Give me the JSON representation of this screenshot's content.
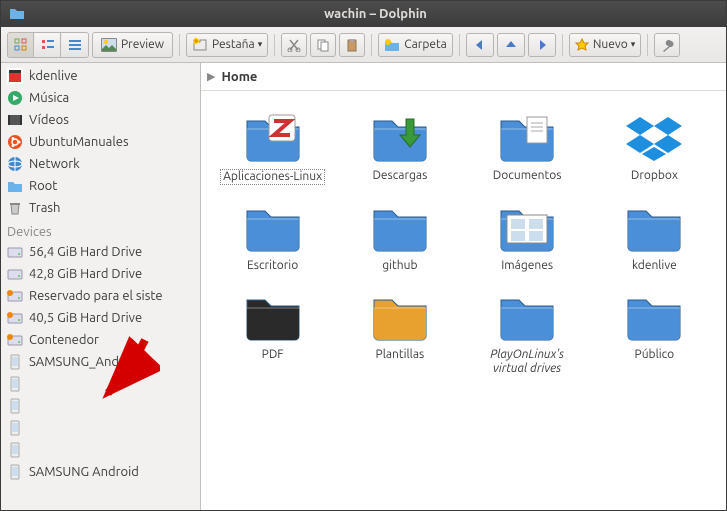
{
  "window": {
    "title": "wachin – Dolphin"
  },
  "toolbar": {
    "preview_label": "Preview",
    "tab_label": "Pestaña",
    "folder_label": "Carpeta",
    "new_label": "Nuevo"
  },
  "breadcrumb": {
    "home": "Home"
  },
  "sidebar": {
    "places": [
      {
        "label": "kdenlive",
        "icon": "app-red"
      },
      {
        "label": "Música",
        "icon": "media-play"
      },
      {
        "label": "Vídeos",
        "icon": "video"
      },
      {
        "label": "UbuntuManuales",
        "icon": "ubuntu"
      },
      {
        "label": "Network",
        "icon": "network"
      },
      {
        "label": "Root",
        "icon": "folder-small"
      },
      {
        "label": "Trash",
        "icon": "trash"
      }
    ],
    "devices_header": "Devices",
    "devices": [
      {
        "label": "56,4 GiB Hard Drive",
        "icon": "drive"
      },
      {
        "label": "42,8 GiB Hard Drive",
        "icon": "drive"
      },
      {
        "label": "Reservado para el siste",
        "icon": "drive-orange"
      },
      {
        "label": "40,5 GiB Hard Drive",
        "icon": "drive-orange"
      },
      {
        "label": "Contenedor",
        "icon": "drive-orange"
      },
      {
        "label": "SAMSUNG_Android",
        "icon": "phone"
      },
      {
        "label": "",
        "icon": "phone"
      },
      {
        "label": "",
        "icon": "phone"
      },
      {
        "label": "",
        "icon": "phone"
      },
      {
        "label": "",
        "icon": "phone"
      },
      {
        "label": "SAMSUNG Android",
        "icon": "phone"
      }
    ]
  },
  "grid": {
    "items": [
      {
        "label": "Aplicaciones-Linux",
        "icon": "folder-zotero",
        "selected": true
      },
      {
        "label": "Descargas",
        "icon": "folder-download"
      },
      {
        "label": "Documentos",
        "icon": "folder-docs"
      },
      {
        "label": "Dropbox",
        "icon": "dropbox"
      },
      {
        "label": "Escritorio",
        "icon": "folder"
      },
      {
        "label": "github",
        "icon": "folder"
      },
      {
        "label": "Imágenes",
        "icon": "folder-images"
      },
      {
        "label": "kdenlive",
        "icon": "folder"
      },
      {
        "label": "PDF",
        "icon": "folder-dark"
      },
      {
        "label": "Plantillas",
        "icon": "folder-yellow"
      },
      {
        "label": "PlayOnLinux's virtual drives",
        "icon": "folder",
        "italic": true
      },
      {
        "label": "Público",
        "icon": "folder"
      }
    ]
  },
  "annotation": {
    "arrow_target": "SAMSUNG_Android"
  }
}
